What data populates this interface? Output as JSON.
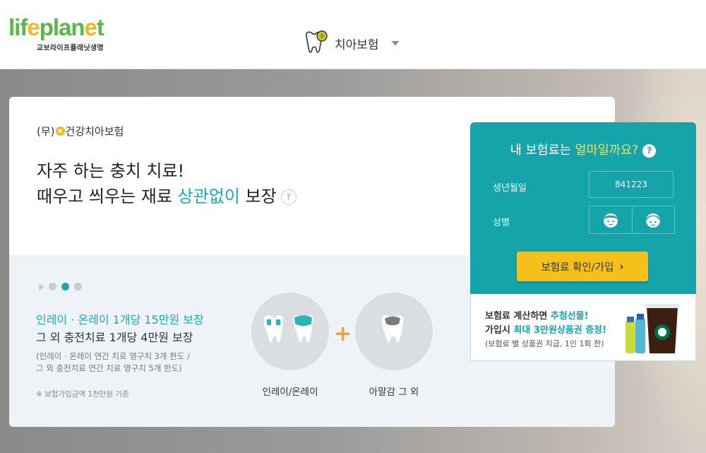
{
  "header": {
    "logo_left": "lif",
    "logo_sep": "e",
    "logo_mid": "plan",
    "logo_sep2": "e",
    "logo_right": "t",
    "logo_sub": "교보라이프플래닛생명",
    "product_select": "치아보험"
  },
  "card": {
    "product_prefix": "(무)",
    "product_badge": "e",
    "product_name": "건강치아보험",
    "headline_line1": "자주 하는 충치 치료!",
    "headline_line2_a": "때우고 씌우는 재료 ",
    "headline_line2_accent": "상관없이",
    "headline_line2_b": " 보장",
    "help": "?",
    "benefit_line1": "인레이 · 온레이 1개당 15만원 보장",
    "benefit_line2": "그 외 충전치료 1개당 4만원 보장",
    "note_line1": "(인레이 · 온레이 연간 치료 영구치 3개 한도 /",
    "note_line2": "그 외 충전치료 연간 치료 영구치 5개 한도)",
    "footnote": "※ 보험가입금액 1천만원 기준",
    "plus": "+",
    "caption_left": "인레이/온레이",
    "caption_right": "아말감 그 외"
  },
  "slider": {
    "count": 3,
    "active": 1
  },
  "quote": {
    "title_a": "내 보험료는 ",
    "title_hl": "얼마일까요?",
    "help": "?",
    "birth_label": "생년월일",
    "birth_value": "841223",
    "gender_label": "성별",
    "cta_label": "보험료 확인/가입",
    "cta_arrow": "›"
  },
  "promo": {
    "l1_a": "보험료 계산하면 ",
    "l1_hl": "추첨선물!",
    "l2_a": "가입시 ",
    "l2_hl": "최대 3만원상품권 증정!",
    "l3": "(보험료 별 상품권 지급, 1인 1회 한)"
  },
  "colors": {
    "brand_green": "#58b945",
    "brand_yellow": "#f3b81e",
    "teal": "#16a4ab",
    "cta_yellow": "#f5c01c"
  },
  "icons": [
    "tooth-plus-icon",
    "chevron-down-icon",
    "play-icon",
    "male-face-icon",
    "female-face-icon",
    "help-icon",
    "tooth-inlay-icon",
    "tooth-amalgam-icon"
  ]
}
